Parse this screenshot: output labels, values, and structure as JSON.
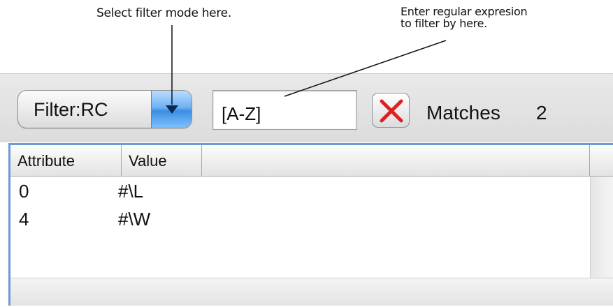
{
  "annotations": {
    "filter_mode_note": "Select filter mode here.",
    "regex_note_line1": "Enter regular expresion",
    "regex_note_line2": "to filter by here."
  },
  "toolbar": {
    "filter_select_value": "Filter:RC",
    "regex_value": "[A-Z]",
    "clear_icon": "red-x-icon",
    "matches_label": "Matches",
    "matches_count": "2"
  },
  "table": {
    "columns": [
      "Attribute",
      "Value",
      ""
    ],
    "rows": [
      {
        "attribute": "0",
        "value": "#\\L"
      },
      {
        "attribute": "4",
        "value": "#\\W"
      }
    ]
  },
  "colors": {
    "focus_border": "#6b9ad6",
    "dropdown_accent": "#3b8ee2",
    "clear_x": "#e02020"
  }
}
